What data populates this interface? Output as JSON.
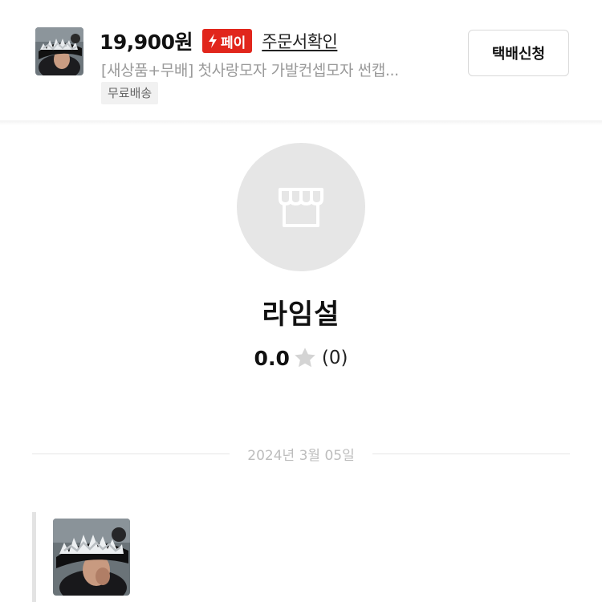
{
  "product": {
    "price": "19,900원",
    "pay_badge": "페이",
    "order_link": "주문서확인",
    "title": "[새상품+무배] 첫사랑모자 가발컨셉모자 썬캡...",
    "shipping_tag": "무료배송",
    "ship_button": "택배신청",
    "thumbnail": "person-in-fur-visor-hat-photo"
  },
  "shop": {
    "avatar_icon": "store-icon",
    "name": "라임설",
    "rating": "0.0",
    "review_count": "(0)",
    "star_icon": "star-icon"
  },
  "chat": {
    "date": "2024년 3월 05일",
    "message_image": "person-in-fur-visor-hat-photo"
  },
  "colors": {
    "pay_badge": "#e1261c",
    "avatar_bg": "#e6e6e6",
    "muted_text": "#9a9a9a"
  }
}
